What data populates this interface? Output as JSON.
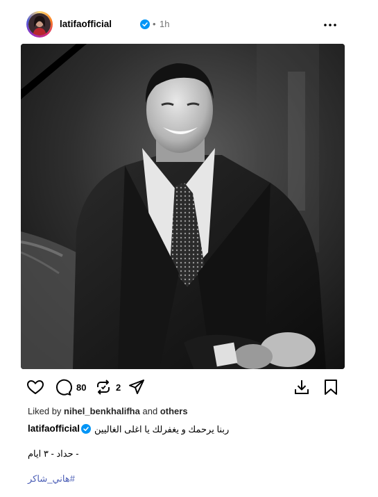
{
  "post": {
    "username": "latifaofficial",
    "separator": "•",
    "time": "1h",
    "image_alt": "Black and white portrait with mourning ribbon",
    "actions": {
      "comments_count": "80",
      "reposts_count": "2"
    },
    "liked_by": {
      "prefix": "Liked by",
      "user": "nihel_benkhalifha",
      "connector": "and",
      "others": "others"
    },
    "caption": {
      "username": "latifaofficial",
      "text": "ربنا يرحمك و يغفرلك يا اغلى الغاليين",
      "line2": "حداد - ٣ ايام -",
      "hashtag": "#هاني_شاكر"
    },
    "icons": {
      "verified": "verified-badge-icon",
      "more": "more-options-icon",
      "like": "heart-icon",
      "comment": "comment-icon",
      "repost": "repost-icon",
      "share": "share-icon",
      "save": "download-icon",
      "bookmark": "bookmark-icon"
    },
    "colors": {
      "verified": "#0095f6",
      "hashtag": "#4a5db5",
      "muted": "#737373"
    }
  }
}
